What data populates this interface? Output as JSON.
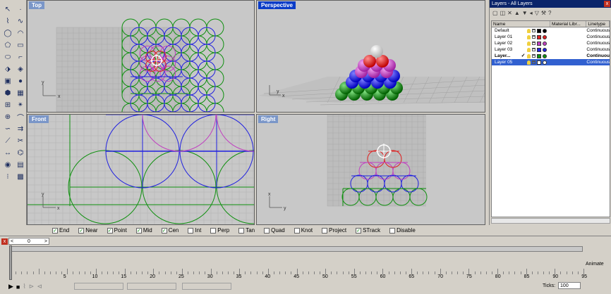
{
  "viewports": {
    "top": {
      "label": "Top"
    },
    "perspective": {
      "label": "Perspective"
    },
    "front": {
      "label": "Front"
    },
    "right": {
      "label": "Right"
    }
  },
  "axis": {
    "x": "x",
    "y": "y"
  },
  "layers_panel": {
    "title": "Layers - All Layers",
    "close": "x",
    "columns": {
      "name": "Name",
      "material": "Material Libr...",
      "linetype": "Linetype"
    },
    "rows": [
      {
        "name": "Default",
        "linetype": "Continuous",
        "swatch": "#000000",
        "dot": "#000000",
        "current": "",
        "selected": false,
        "bold": false
      },
      {
        "name": "Layer 01",
        "linetype": "Continuous",
        "swatch": "#e02020",
        "dot": "#e02020",
        "current": "",
        "selected": false,
        "bold": false
      },
      {
        "name": "Layer 02",
        "linetype": "Continuous",
        "swatch": "#c040c0",
        "dot": "#c040c0",
        "current": "",
        "selected": false,
        "bold": false
      },
      {
        "name": "Layer 03",
        "linetype": "Continuous",
        "swatch": "#2020e0",
        "dot": "#2020e0",
        "current": "",
        "selected": false,
        "bold": false
      },
      {
        "name": "Layer...",
        "linetype": "Continuous",
        "swatch": "#109010",
        "dot": "#109010",
        "current": "✓",
        "selected": false,
        "bold": true
      },
      {
        "name": "Layer 05",
        "linetype": "Continuous",
        "swatch": "#ffffff",
        "dot": "#ffffff",
        "current": "",
        "selected": true,
        "bold": false
      }
    ]
  },
  "osnap": [
    {
      "label": "End",
      "checked": true
    },
    {
      "label": "Near",
      "checked": true
    },
    {
      "label": "Point",
      "checked": true
    },
    {
      "label": "Mid",
      "checked": true
    },
    {
      "label": "Cen",
      "checked": true
    },
    {
      "label": "Int",
      "checked": false
    },
    {
      "label": "Perp",
      "checked": false
    },
    {
      "label": "Tan",
      "checked": false
    },
    {
      "label": "Quad",
      "checked": false
    },
    {
      "label": "Knot",
      "checked": false
    },
    {
      "label": "Project",
      "checked": false
    },
    {
      "label": "STrack",
      "checked": true
    },
    {
      "label": "Disable",
      "checked": false
    }
  ],
  "timeline": {
    "close": "x",
    "frame": "0",
    "ticks": [
      "5",
      "10",
      "15",
      "20",
      "25",
      "30",
      "35",
      "40",
      "45",
      "50",
      "55",
      "60",
      "65",
      "70",
      "75",
      "80",
      "85",
      "90",
      "95"
    ],
    "animate_label": "Animate",
    "ticks_label": "Ticks:",
    "ticks_value": "100"
  },
  "colors": {
    "red": "#e02020",
    "purple": "#c040c0",
    "blue": "#2020e0",
    "green": "#109010",
    "active_title": "#0a3cc8"
  }
}
